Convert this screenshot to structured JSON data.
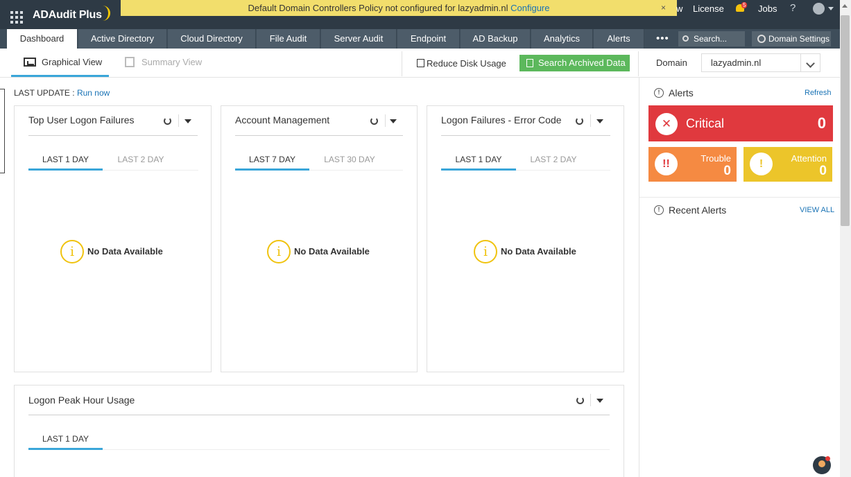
{
  "header": {
    "app_name": "ADAudit Plus",
    "notice_text": "Default Domain Controllers Policy not configured for lazyadmin.nl",
    "notice_link": "Configure",
    "notice_close": "×",
    "partial_link": "w",
    "license": "License",
    "jobs": "Jobs",
    "help": "?",
    "notification_count": "5"
  },
  "nav": {
    "tabs": [
      "Dashboard",
      "Active Directory",
      "Cloud Directory",
      "File Audit",
      "Server Audit",
      "Endpoint",
      "AD Backup",
      "Analytics",
      "Alerts"
    ],
    "more": "•••",
    "search_placeholder": "Search...",
    "domain_settings": "Domain Settings"
  },
  "toolbar": {
    "graphical_view": "Graphical View",
    "summary_view": "Summary View",
    "reduce_disk": "Reduce Disk Usage",
    "search_archived": "Search Archived Data",
    "domain_label": "Domain",
    "domain_value": "lazyadmin.nl"
  },
  "last_update": {
    "label": "LAST UPDATE :",
    "action": "Run now"
  },
  "widgets": [
    {
      "title": "Top User Logon Failures",
      "periods": [
        "LAST 1 DAY",
        "LAST 2 DAY"
      ],
      "empty": "No Data Available"
    },
    {
      "title": "Account Management",
      "periods": [
        "LAST 7 DAY",
        "LAST 30 DAY"
      ],
      "empty": "No Data Available"
    },
    {
      "title": "Logon Failures - Error Code",
      "periods": [
        "LAST 1 DAY",
        "LAST 2 DAY"
      ],
      "empty": "No Data Available"
    },
    {
      "title": "Logon Peak Hour Usage",
      "periods": [
        "LAST 1 DAY"
      ]
    }
  ],
  "alerts": {
    "title": "Alerts",
    "refresh": "Refresh",
    "critical_label": "Critical",
    "critical_count": "0",
    "trouble_label": "Trouble",
    "trouble_count": "0",
    "attention_label": "Attention",
    "attention_count": "0",
    "recent_title": "Recent Alerts",
    "view_all": "VIEW ALL"
  },
  "colors": {
    "header_bg": "#2e3a45",
    "notice_bg": "#f2de6c",
    "accent": "#3aa6d9",
    "critical": "#e0393e",
    "trouble": "#f58a42",
    "attention": "#ecc52a",
    "archive_button": "#5cb85c"
  }
}
